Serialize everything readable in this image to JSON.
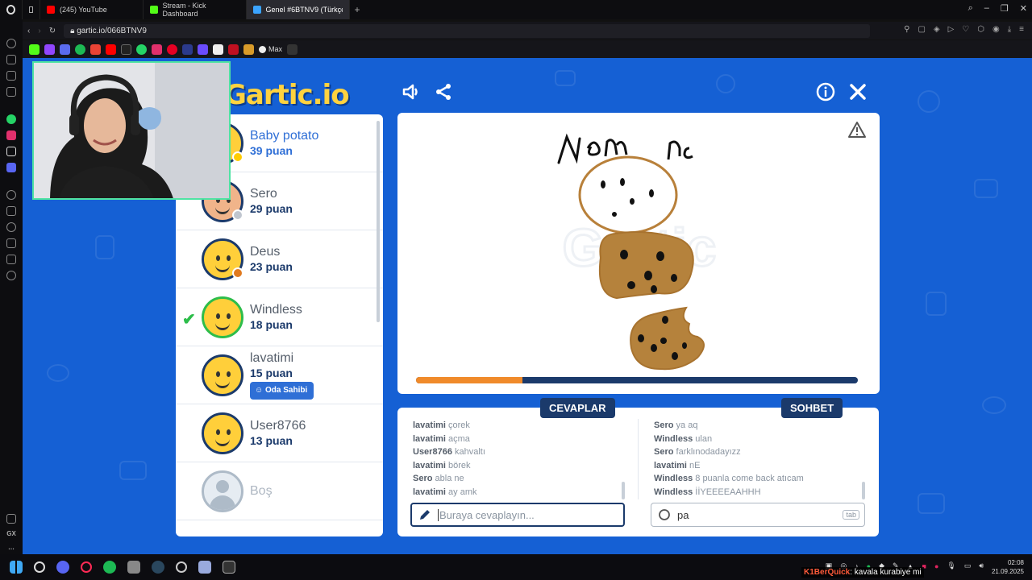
{
  "browser": {
    "tabs": [
      {
        "label": "(245) YouTube",
        "color": "#ff0000"
      },
      {
        "label": "Stream - Kick Dashboard",
        "color": "#53fc18"
      },
      {
        "label": "Genel #6BTNV9 (Türkçe)",
        "color": "#3ba4ff"
      }
    ],
    "url": "gartic.io/066BTNV9",
    "bookmark_label": "Max"
  },
  "game": {
    "logo": "Gartic.io",
    "players": [
      {
        "name": "Baby potato",
        "score": "39 puan",
        "dot_color": "#ffcc00",
        "me": true,
        "guessed": false
      },
      {
        "name": "Sero",
        "score": "29 puan",
        "dot_color": "#c0c6cf",
        "me": false,
        "guessed": false
      },
      {
        "name": "Deus",
        "score": "23 puan",
        "dot_color": "#e07a1f",
        "me": false,
        "guessed": false
      },
      {
        "name": "Windless",
        "score": "18 puan",
        "dot_color": "",
        "me": false,
        "guessed": true
      },
      {
        "name": "lavatimi",
        "score": "15 puan",
        "dot_color": "",
        "me": false,
        "guessed": false,
        "owner": "Oda Sahibi"
      },
      {
        "name": "User8766",
        "score": "13 puan",
        "dot_color": "",
        "me": false,
        "guessed": false
      }
    ],
    "empty_slot": "Boş",
    "drawing_text": "Nam nı",
    "timer_fraction": 0.24,
    "answers_title": "CEVAPLAR",
    "chat_title": "SOHBET",
    "answers": [
      {
        "user": "lavatimi",
        "text": "çorek"
      },
      {
        "user": "lavatimi",
        "text": "açma"
      },
      {
        "user": "User8766",
        "text": "kahvaltı"
      },
      {
        "user": "lavatimi",
        "text": "börek"
      },
      {
        "user": "Sero",
        "text": "abla ne"
      },
      {
        "user": "lavatimi",
        "text": "ay amk"
      }
    ],
    "chat": [
      {
        "user": "Sero",
        "text": "ya aq"
      },
      {
        "user": "Windless",
        "text": "ulan"
      },
      {
        "user": "Sero",
        "text": "farklınodadayızz"
      },
      {
        "user": "lavatimi",
        "text": "nE"
      },
      {
        "user": "Windless",
        "text": "8 puanla come back atıcam"
      },
      {
        "user": "Windless",
        "text": "İİYEEEEAAHHH"
      }
    ],
    "answer_placeholder": "Buraya cevaplayın...",
    "chat_value": "pa",
    "chat_hint": "tab"
  },
  "stream_overlay": {
    "user": "K1BerQuick",
    "message": ": kavala kurabiye mi"
  },
  "taskbar": {
    "time": "02:08",
    "date": "21.09.2025"
  }
}
